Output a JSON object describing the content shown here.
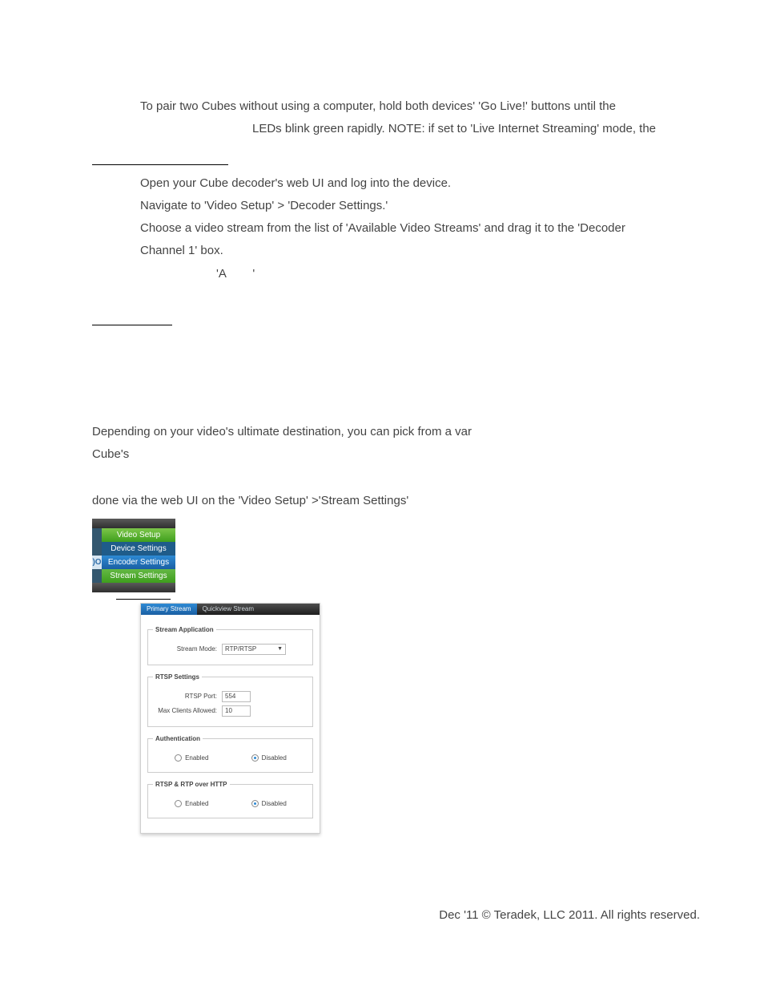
{
  "doc": {
    "p1": "To pair two Cubes without using a computer, hold both devices' 'Go Live!' buttons until the",
    "p1b": "LEDs blink green rapidly. NOTE: if set to 'Live Internet Streaming' mode, the",
    "step1": "Open your Cube decoder's web UI and log into the device.",
    "step2": "Navigate to 'Video Setup'  > 'Decoder Settings.'",
    "step3a": "Choose a video stream from the list of 'Available Video Streams' and drag it to the 'Decoder",
    "step3b": "Channel 1' box.",
    "quote_a": "'A        '",
    "p2": "Depending on your video's ultimate destination, you can pick from a var",
    "p2b": "Cube's",
    "p3": "done via the web UI on the 'Video Setup' >'Stream Settings'"
  },
  "sidemenu": {
    "video_setup": "Video Setup",
    "device_settings": "Device Settings",
    "encoder_settings": "Encoder Settings",
    "stream_settings": "Stream Settings",
    "arrow": ")O"
  },
  "panel": {
    "tabs": {
      "primary": "Primary Stream",
      "quick": "Quickview Stream"
    },
    "grp_app": {
      "legend": "Stream Application",
      "mode_label": "Stream Mode:",
      "mode_value": "RTP/RTSP"
    },
    "grp_rtsp": {
      "legend": "RTSP Settings",
      "port_label": "RTSP Port:",
      "port_value": "554",
      "max_label": "Max Clients Allowed:",
      "max_value": "10"
    },
    "grp_auth": {
      "legend": "Authentication",
      "enabled": "Enabled",
      "disabled": "Disabled"
    },
    "grp_http": {
      "legend": "RTSP & RTP over HTTP",
      "enabled": "Enabled",
      "disabled": "Disabled"
    }
  },
  "footer": "Dec '11 © Teradek, LLC 2011. All rights reserved."
}
